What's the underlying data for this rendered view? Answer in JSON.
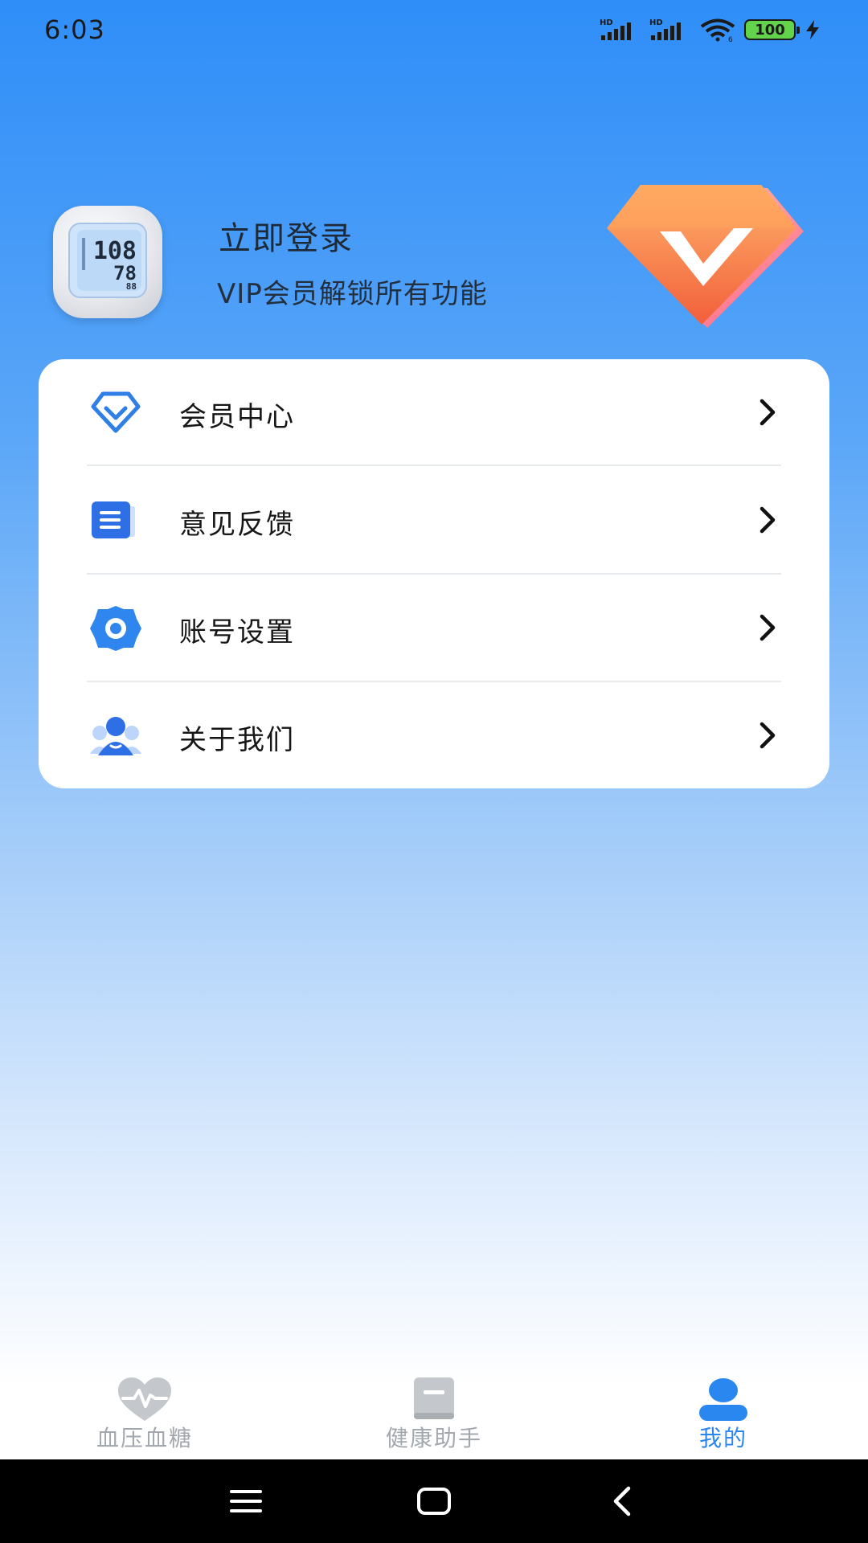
{
  "status_bar": {
    "time": "6:03",
    "battery": "100",
    "icons": [
      "hd-signal-icon",
      "hd-signal-icon",
      "wifi-icon",
      "battery-icon",
      "charging-icon"
    ]
  },
  "profile": {
    "login_title": "立即登录",
    "subtitle": "VIP会员解锁所有功能",
    "avatar_icon": "blood-pressure-monitor-icon",
    "badge_icon": "vip-diamond-icon",
    "monitor_reading": {
      "sys": "108",
      "dia": "78",
      "pulse": "88"
    }
  },
  "menu": {
    "items": [
      {
        "label": "会员中心",
        "icon": "diamond-icon"
      },
      {
        "label": "意见反馈",
        "icon": "document-icon"
      },
      {
        "label": "账号设置",
        "icon": "gear-icon"
      },
      {
        "label": "关于我们",
        "icon": "people-icon"
      }
    ]
  },
  "tabs": [
    {
      "label": "血压血糖",
      "icon": "heart-pulse-icon",
      "active": false
    },
    {
      "label": "健康助手",
      "icon": "book-icon",
      "active": false
    },
    {
      "label": "我的",
      "icon": "user-icon",
      "active": true
    }
  ],
  "colors": {
    "accent": "#2a87f0",
    "vip_orange": "#f7783a",
    "inactive_tab": "#a3a8ae",
    "card_bg": "#ffffff"
  },
  "nav": {
    "buttons": [
      "menu-icon",
      "home-icon",
      "back-icon"
    ]
  }
}
